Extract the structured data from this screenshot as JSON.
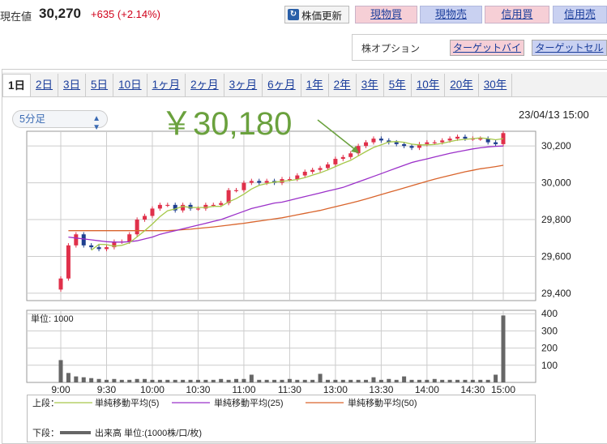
{
  "header": {
    "price_label": "現在値",
    "price_value": "30,270",
    "price_change": "+635 (+2.14%)",
    "refresh_label": "株価更新",
    "buttons": [
      "現物買",
      "現物売",
      "信用買",
      "信用売"
    ],
    "option_label": "株オプション",
    "option_buttons": [
      "ターゲットバイ",
      "ターゲットセル"
    ]
  },
  "tabs": [
    "1日",
    "2日",
    "3日",
    "5日",
    "10日",
    "1ヶ月",
    "2ヶ月",
    "3ヶ月",
    "6ヶ月",
    "1年",
    "2年",
    "3年",
    "5年",
    "10年",
    "20年",
    "30年"
  ],
  "active_tab": "1日",
  "interval_select": "5分足",
  "datetime": "23/04/13 15:00",
  "annotation": "￥30,180",
  "legend": {
    "upper_label": "上段：",
    "lower_label": "下段：",
    "ma5": "単純移動平均(5)",
    "ma25": "単純移動平均(25)",
    "ma50": "単純移動平均(50)",
    "volume": "出来高 単位:(1000株/口/枚)",
    "volume_unit_label": "単位: 1000"
  },
  "colors": {
    "up": "#e0304a",
    "down": "#1f3f8f",
    "ma5": "#a6c84a",
    "ma25": "#9b30c9",
    "ma50": "#d9642c",
    "annotation": "#6aa13d",
    "volume": "#666666"
  },
  "chart_data": {
    "type": "candlestick",
    "x_ticks": [
      "9:00",
      "9:30",
      "10:00",
      "10:30",
      "11:00",
      "11:30",
      "13:00",
      "13:30",
      "14:00",
      "14:30",
      "15:00"
    ],
    "price_ticks": [
      "30,200",
      "30,000",
      "29,800",
      "29,600",
      "29,400"
    ],
    "ylim": [
      29360,
      30280
    ],
    "volume_ticks": [
      "400",
      "300",
      "200",
      "100"
    ],
    "volume_ylim": [
      0,
      420
    ],
    "closes": [
      29480,
      29660,
      29720,
      29660,
      29650,
      29640,
      29650,
      29680,
      29680,
      29720,
      29800,
      29820,
      29860,
      29880,
      29880,
      29850,
      29880,
      29860,
      29860,
      29880,
      29880,
      29890,
      29960,
      29960,
      30000,
      30010,
      30000,
      30010,
      30000,
      30020,
      30020,
      30040,
      30060,
      30070,
      30080,
      30100,
      30130,
      30140,
      30160,
      30200,
      30220,
      30240,
      30230,
      30220,
      30210,
      30200,
      30190,
      30210,
      30220,
      30220,
      30230,
      30240,
      30250,
      30240,
      30240,
      30240,
      30220,
      30210,
      30270
    ],
    "ma5": [
      null,
      null,
      null,
      null,
      29634,
      29666,
      29664,
      29656,
      29660,
      29674,
      29706,
      29740,
      29776,
      29816,
      29848,
      29858,
      29872,
      29866,
      29866,
      29866,
      29872,
      29872,
      29896,
      29914,
      29938,
      29966,
      29986,
      29996,
      30004,
      30008,
      30012,
      30018,
      30028,
      30042,
      30054,
      30070,
      30088,
      30106,
      30122,
      30146,
      30170,
      30192,
      30206,
      30222,
      30224,
      30220,
      30210,
      30206,
      30206,
      30208,
      30214,
      30224,
      30232,
      30236,
      30240,
      30244,
      30240,
      30234,
      30240
    ],
    "ma25": [
      null,
      29705,
      29700,
      29695,
      29690,
      29685,
      29680,
      29678,
      29678,
      29680,
      29685,
      29695,
      29705,
      29720,
      29730,
      29740,
      29750,
      29760,
      29770,
      29780,
      29790,
      29800,
      29815,
      29830,
      29845,
      29860,
      29870,
      29880,
      29890,
      29895,
      29905,
      29915,
      29925,
      29935,
      29945,
      29955,
      29965,
      29975,
      29990,
      30005,
      30020,
      30035,
      30050,
      30065,
      30080,
      30095,
      30110,
      30120,
      30130,
      30140,
      30150,
      30160,
      30168,
      30176,
      30184,
      30190,
      30195,
      30198,
      30200
    ],
    "ma50": [
      null,
      29740,
      29740,
      29740,
      29740,
      29740,
      29740,
      29740,
      29740,
      29740,
      29740,
      29740,
      29740,
      29740,
      29740,
      29742,
      29745,
      29748,
      29752,
      29756,
      29760,
      29765,
      29770,
      29775,
      29780,
      29786,
      29792,
      29798,
      29804,
      29810,
      29818,
      29826,
      29834,
      29842,
      29850,
      29860,
      29870,
      29880,
      29890,
      29900,
      29912,
      29924,
      29936,
      29948,
      29960,
      29972,
      29984,
      29996,
      30008,
      30020,
      30030,
      30040,
      30050,
      30060,
      30068,
      30076,
      30082,
      30088,
      30095
    ],
    "volume": [
      130,
      55,
      35,
      30,
      25,
      20,
      15,
      20,
      15,
      15,
      20,
      20,
      15,
      15,
      15,
      15,
      15,
      15,
      15,
      15,
      15,
      20,
      15,
      20,
      20,
      45,
      15,
      15,
      15,
      15,
      20,
      15,
      15,
      15,
      50,
      15,
      15,
      15,
      15,
      15,
      15,
      30,
      15,
      20,
      15,
      35,
      15,
      15,
      15,
      20,
      15,
      15,
      15,
      15,
      15,
      15,
      15,
      45,
      390
    ]
  }
}
